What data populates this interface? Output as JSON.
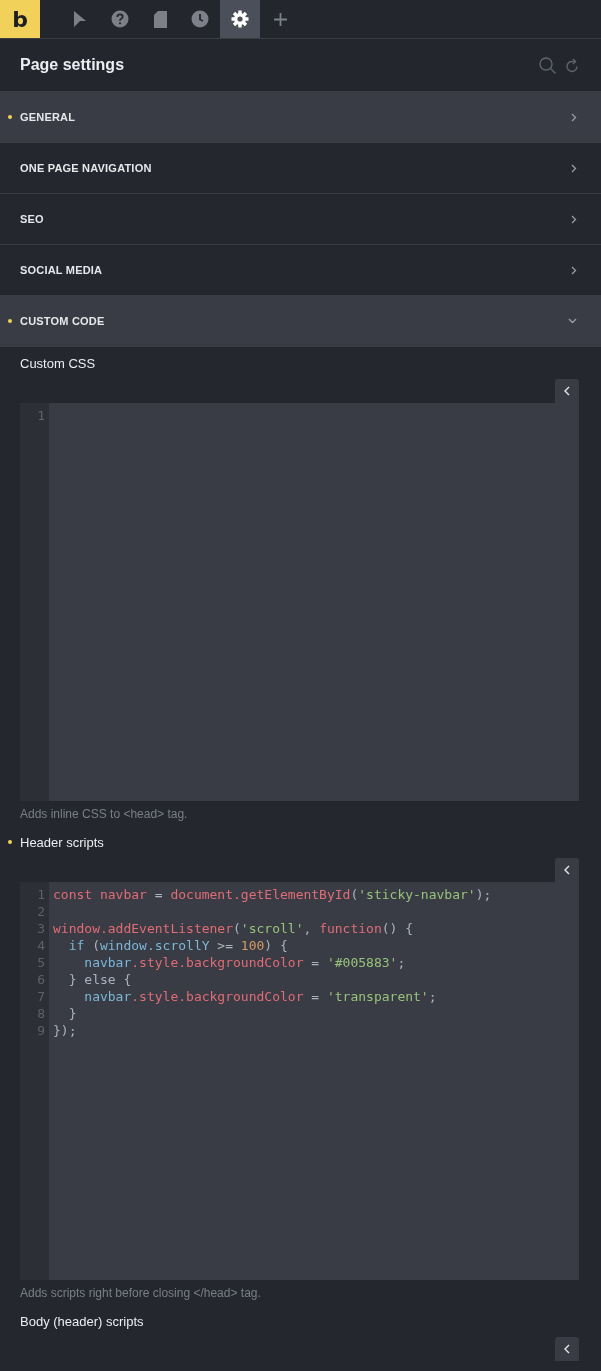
{
  "logo": "b",
  "toolbar_tabs": [
    {
      "kind": "pointer",
      "selected": false
    },
    {
      "kind": "help",
      "selected": false
    },
    {
      "kind": "page",
      "selected": false
    },
    {
      "kind": "history",
      "selected": false
    },
    {
      "kind": "settings",
      "selected": true
    },
    {
      "kind": "add",
      "selected": false
    }
  ],
  "panel": {
    "title": "Page settings"
  },
  "sections": [
    {
      "label": "GENERAL",
      "modified": true,
      "highlighted": true,
      "expanded": false
    },
    {
      "label": "ONE PAGE NAVIGATION",
      "modified": false,
      "highlighted": false,
      "expanded": false
    },
    {
      "label": "SEO",
      "modified": false,
      "highlighted": false,
      "expanded": false
    },
    {
      "label": "SOCIAL MEDIA",
      "modified": false,
      "highlighted": false,
      "expanded": false
    },
    {
      "label": "CUSTOM CODE",
      "modified": true,
      "highlighted": true,
      "expanded": true
    }
  ],
  "code_fields": [
    {
      "label": "Custom CSS",
      "modified": false,
      "help": "Adds inline CSS to <head> tag.",
      "lines": [
        {
          "number": "1"
        }
      ]
    },
    {
      "label": "Header scripts",
      "modified": true,
      "help": "Adds scripts right before closing </head> tag.",
      "lines": [
        {
          "number": "1",
          "tokens": [
            {
              "kind": "keyword",
              "text": "const navbar"
            },
            {
              "kind": "plain",
              "text": " = "
            },
            {
              "kind": "keyword",
              "text": "document.getElementById"
            },
            {
              "kind": "plain",
              "text": "("
            },
            {
              "kind": "string",
              "text": "'sticky-navbar'"
            },
            {
              "kind": "plain",
              "text": ");"
            }
          ]
        },
        {
          "number": "2"
        },
        {
          "number": "3",
          "tokens": [
            {
              "kind": "keyword",
              "text": "window.addEventListener"
            },
            {
              "kind": "plain",
              "text": "("
            },
            {
              "kind": "string",
              "text": "'scroll'"
            },
            {
              "kind": "plain",
              "text": ", "
            },
            {
              "kind": "keyword",
              "text": "function"
            },
            {
              "kind": "plain",
              "text": "() {"
            }
          ]
        },
        {
          "number": "4",
          "tokens": [
            {
              "kind": "variable",
              "text": "  if"
            },
            {
              "kind": "plain",
              "text": " ("
            },
            {
              "kind": "variable",
              "text": "window.scrollY"
            },
            {
              "kind": "plain",
              "text": " >= "
            },
            {
              "kind": "number",
              "text": "100"
            },
            {
              "kind": "plain",
              "text": ") {"
            }
          ]
        },
        {
          "number": "5",
          "tokens": [
            {
              "kind": "variable",
              "text": "    navbar"
            },
            {
              "kind": "keyword",
              "text": ".style.backgroundColor"
            },
            {
              "kind": "plain",
              "text": " = "
            },
            {
              "kind": "string",
              "text": "'#005883'"
            },
            {
              "kind": "plain",
              "text": ";"
            }
          ]
        },
        {
          "number": "6",
          "tokens": [
            {
              "kind": "plain",
              "text": "  } else {"
            }
          ]
        },
        {
          "number": "7",
          "tokens": [
            {
              "kind": "variable",
              "text": "    navbar"
            },
            {
              "kind": "keyword",
              "text": ".style.backgroundColor"
            },
            {
              "kind": "plain",
              "text": " = "
            },
            {
              "kind": "string",
              "text": "'transparent'"
            },
            {
              "kind": "plain",
              "text": ";"
            }
          ]
        },
        {
          "number": "8",
          "tokens": [
            {
              "kind": "plain",
              "text": "  }"
            }
          ]
        },
        {
          "number": "9",
          "tokens": [
            {
              "kind": "plain",
              "text": "});"
            }
          ]
        }
      ]
    },
    {
      "label": "Body (header) scripts",
      "modified": false
    }
  ]
}
